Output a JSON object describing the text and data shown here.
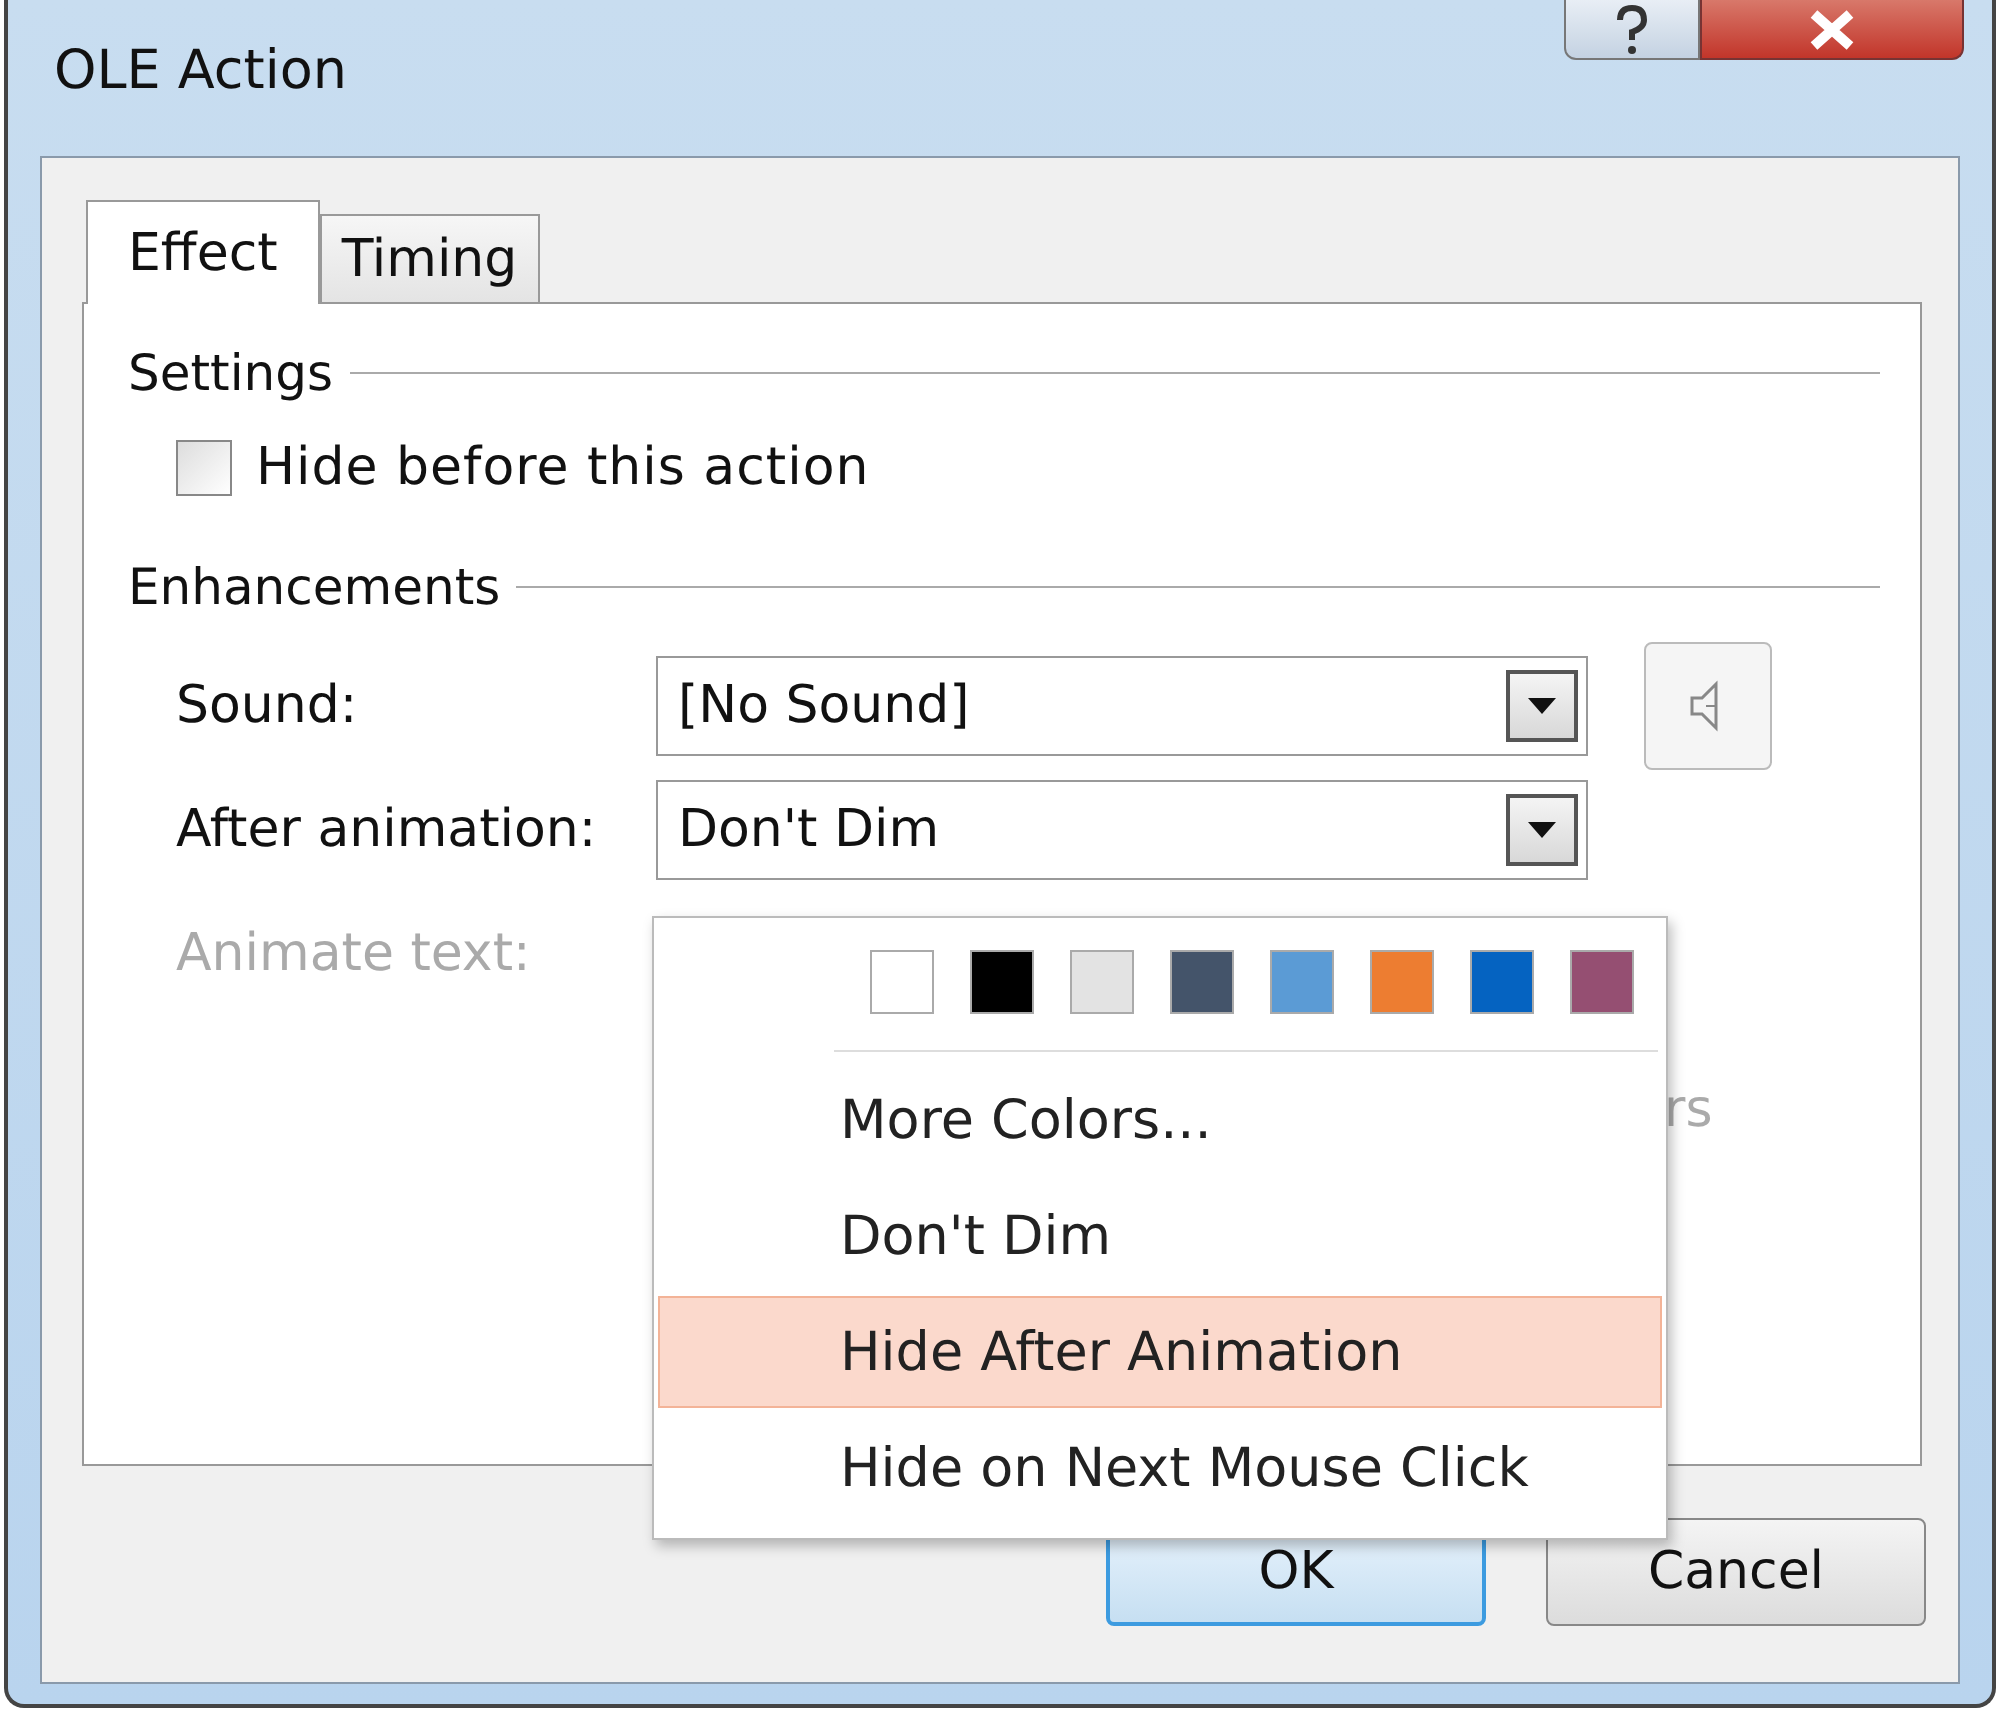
{
  "window": {
    "title": "OLE Action"
  },
  "tabs": [
    {
      "label": "Effect",
      "selected": true
    },
    {
      "label": "Timing",
      "selected": false
    }
  ],
  "settings": {
    "heading": "Settings",
    "hide_before": {
      "label": "Hide before this action",
      "checked": false
    }
  },
  "enhancements": {
    "heading": "Enhancements",
    "fields": [
      {
        "label": "Sound:",
        "value": "[No Sound]",
        "disabled": false
      },
      {
        "label": "After animation:",
        "value": "Don't Dim",
        "disabled": false
      },
      {
        "label": "Animate text:",
        "disabled": true
      }
    ],
    "hidden_fragment": "rs"
  },
  "dropdown_menu": {
    "swatches": [
      {
        "color": "#ffffff"
      },
      {
        "color": "#000000"
      },
      {
        "color": "#e3e3e3"
      },
      {
        "color": "#44546a"
      },
      {
        "color": "#5b9bd5"
      },
      {
        "color": "#ed7d31"
      },
      {
        "color": "#0563c1"
      },
      {
        "color": "#954f72"
      }
    ],
    "items": [
      {
        "label": "More Colors...",
        "selected": false
      },
      {
        "label": "Don't Dim",
        "selected": false
      },
      {
        "label": "Hide After Animation",
        "selected": true
      },
      {
        "label": "Hide on Next Mouse Click",
        "selected": false
      }
    ]
  },
  "buttons": [
    {
      "label": "OK",
      "default": true
    },
    {
      "label": "Cancel",
      "default": false
    }
  ]
}
